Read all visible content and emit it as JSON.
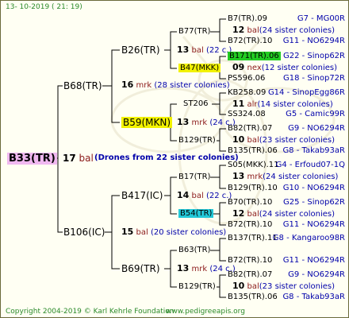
{
  "header": {
    "date": "13- 10-2019 ( 21: 19)"
  },
  "footer": {
    "copyright": "Copyright 2004-2019 © Karl Kehrle Foundation",
    "site": "www.pedigreeapis.org"
  },
  "root": {
    "name": "B33(TR)",
    "num": "17",
    "type": "bal",
    "note": "(Drones from 22 sister colonies)"
  },
  "gen1": [
    {
      "name": "B68(TR)",
      "num": "16",
      "type": "mrk",
      "note": "(28 sister colonies)"
    },
    {
      "name": "B106(IC)",
      "num": "15",
      "type": "bal",
      "note": "(20 sister colonies)"
    }
  ],
  "gen2": [
    {
      "name": "B26(TR)",
      "num": "",
      "type": "",
      "note": ""
    },
    {
      "name": "B59(MKN)",
      "num": "13",
      "type": "mrk",
      "note": "(24 c.)"
    },
    {
      "name": "B417(IC)",
      "num": "14",
      "type": "bal",
      "note": "(22 c.)"
    },
    {
      "name": "B69(TR)",
      "num": "13",
      "type": "mrk",
      "note": "(24 c.)"
    }
  ],
  "gen3": [
    {
      "name": "B77(TR)",
      "num": "13",
      "type": "bal",
      "note": "(22 c.)"
    },
    {
      "name": "B47(MKK)",
      "num": "",
      "type": "",
      "note": ""
    },
    {
      "name": "ST206",
      "num": "",
      "type": "",
      "note": ""
    },
    {
      "name": "B129(TR)",
      "num": "",
      "type": "",
      "note": ""
    },
    {
      "name": "B17(TR)",
      "num": "13",
      "type": "mrk",
      "note": "(24 sister colonies)"
    },
    {
      "name": "B54(TR)",
      "num": "",
      "type": "",
      "note": ""
    },
    {
      "name": "B63(TR)",
      "num": "12",
      "type": "bal",
      "note": "(24 sister colonies)"
    },
    {
      "name": "B129(TR)",
      "num": "",
      "type": "",
      "note": ""
    }
  ],
  "gen4": [
    {
      "name": "B7(TR).09",
      "code": "G7 - MG00R"
    },
    {
      "name": "B72(TR).10",
      "code": "G11 - NO6294R"
    },
    {
      "name": "B171(TR).06",
      "code": "G22 - Sinop62R"
    },
    {
      "name": "PS596.06",
      "code": "G18 - Sinop72R"
    },
    {
      "name": "KB258.09",
      "code": "G14 - SinopEgg86R"
    },
    {
      "name": "SS324.08",
      "code": "G5 - Camic99R"
    },
    {
      "name": "B82(TR).07",
      "code": "G9 - NO6294R"
    },
    {
      "name": "B135(TR).06",
      "code": "G8 - Takab93aR"
    },
    {
      "name": "S05(MKK).11",
      "code": "G4 - Erfoud07-1Q"
    },
    {
      "name": "B129(TR).10",
      "code": "G10 - NO6294R"
    },
    {
      "name": "B70(TR).10",
      "code": "G25 - Sinop62R"
    },
    {
      "name": "B72(TR).10",
      "code": "G11 - NO6294R"
    },
    {
      "name": "B137(TR).11",
      "code": "G8 - Kangaroo98R"
    },
    {
      "name": "B72(TR).10",
      "code": "G11 - NO6294R"
    },
    {
      "name": "B82(TR).07",
      "code": "G9 - NO6294R"
    },
    {
      "name": "B135(TR).06",
      "code": "G8 - Takab93aR"
    }
  ],
  "drone_rows": [
    {
      "num": "12",
      "type": "bal",
      "note": "(24 sister colonies)"
    },
    {
      "num": "09",
      "type": "nex",
      "note": "(12 sister colonies)"
    },
    {
      "num": "11",
      "type": "alr",
      "note": "(14 sister colonies)"
    },
    {
      "num": "10",
      "type": "bal",
      "note": "(23 sister colonies)"
    },
    {
      "num": "13",
      "type": "mrk",
      "note": "(24 sister colonies)"
    },
    {
      "num": "12",
      "type": "bal",
      "note": "(24 sister colonies)"
    },
    {
      "num": "10",
      "type": "bal",
      "note": "(23 sister colonies)"
    }
  ],
  "colors": {
    "highlight_yellow": "#f2f200",
    "highlight_green": "#22cc22",
    "highlight_cyan": "#22c8d8",
    "highlight_pink": "#f0b8f0",
    "code_blue": "#0000aa",
    "type_red": "#8b1a1a",
    "footer_green": "#2a8a2a"
  }
}
